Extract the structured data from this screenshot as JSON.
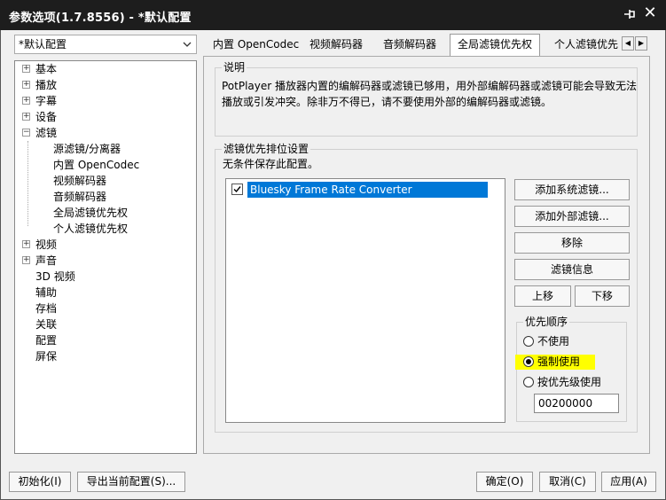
{
  "window": {
    "title": "参数选项(1.7.8556) - *默认配置",
    "pin_icon": "pin-icon",
    "close_icon": "close-icon",
    "close_glyph": "✕"
  },
  "profile": {
    "value": "*默认配置"
  },
  "tree": {
    "items": [
      {
        "label": "基本",
        "expandable": true,
        "expanded": false
      },
      {
        "label": "播放",
        "expandable": true,
        "expanded": false
      },
      {
        "label": "字幕",
        "expandable": true,
        "expanded": false
      },
      {
        "label": "设备",
        "expandable": true,
        "expanded": false
      },
      {
        "label": "滤镜",
        "expandable": true,
        "expanded": true
      },
      {
        "label": "源滤镜/分离器",
        "child": true
      },
      {
        "label": "内置 OpenCodec",
        "child": true
      },
      {
        "label": "视频解码器",
        "child": true
      },
      {
        "label": "音频解码器",
        "child": true
      },
      {
        "label": "全局滤镜优先权",
        "child": true
      },
      {
        "label": "个人滤镜优先权",
        "child": true
      },
      {
        "label": "视频",
        "expandable": true,
        "expanded": false
      },
      {
        "label": "声音",
        "expandable": true,
        "expanded": false
      },
      {
        "label": "3D 视频",
        "expandable": false
      },
      {
        "label": "辅助",
        "expandable": false
      },
      {
        "label": "存档",
        "expandable": false
      },
      {
        "label": "关联",
        "expandable": false
      },
      {
        "label": "配置",
        "expandable": false
      },
      {
        "label": "屏保",
        "expandable": false
      }
    ]
  },
  "tabs": [
    {
      "label": "内置 OpenCodec"
    },
    {
      "label": "视频解码器"
    },
    {
      "label": "音频解码器"
    },
    {
      "label": "全局滤镜优先权",
      "active": true
    },
    {
      "label": "个人滤镜优先"
    }
  ],
  "tab_scroll": {
    "left": "◀",
    "right": "▶"
  },
  "description": {
    "legend": "说明",
    "text": "PotPlayer 播放器内置的编解码器或滤镜已够用，用外部编解码器或滤镜可能会导致无法播放或引发冲突。除非万不得已，请不要使用外部的编解码器或滤镜。"
  },
  "filter_priority": {
    "legend": "滤镜优先排位设置",
    "note": "无条件保存此配置。",
    "list": [
      {
        "name": "Bluesky Frame Rate Converter",
        "checked": true
      }
    ],
    "buttons": {
      "add_system": "添加系统滤镜...",
      "add_external": "添加外部滤镜...",
      "remove": "移除",
      "filter_info": "滤镜信息",
      "move_up": "上移",
      "move_down": "下移"
    },
    "priority": {
      "legend": "优先顺序",
      "options": [
        {
          "label": "不使用",
          "selected": false
        },
        {
          "label": "强制使用",
          "selected": true
        },
        {
          "label": "按优先级使用",
          "selected": false
        }
      ],
      "value": "00200000"
    }
  },
  "footer": {
    "init": "初始化(I)",
    "export": "导出当前配置(S)...",
    "ok": "确定(O)",
    "cancel": "取消(C)",
    "apply": "应用(A)"
  },
  "colors": {
    "titlebar": "#1d1d1d",
    "selection": "#0078d7",
    "highlight": "#ffff00"
  }
}
